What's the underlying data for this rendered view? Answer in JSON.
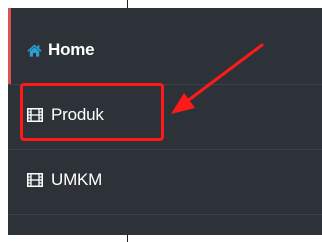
{
  "sidebar": {
    "items": [
      {
        "label": "Home",
        "icon": "home-icon",
        "active": true
      },
      {
        "label": "Produk",
        "icon": "film-icon",
        "active": false,
        "highlighted": true
      },
      {
        "label": "UMKM",
        "icon": "film-icon",
        "active": false
      }
    ]
  },
  "colors": {
    "sidebar_bg": "#2c3237",
    "home_icon": "#2a9fd6",
    "active_bar": "#d9534f",
    "annotation": "#ff1a1a",
    "text": "#ffffff"
  }
}
